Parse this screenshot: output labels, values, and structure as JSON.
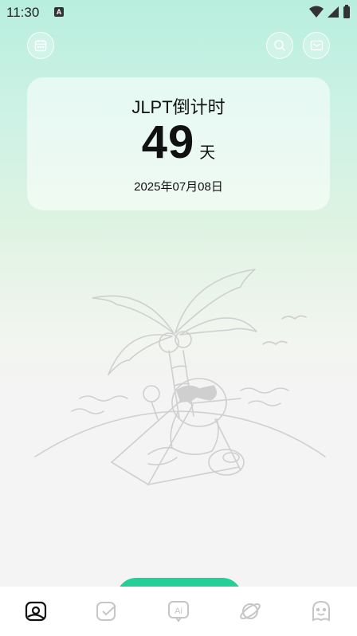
{
  "status_bar": {
    "time": "11:30",
    "notification_icon": "a-letter-icon",
    "indicators": [
      "wifi-icon",
      "signal-icon",
      "battery-icon"
    ]
  },
  "header": {
    "left_button_icon": "calendar-icon",
    "right_button_icons": [
      "search-icon",
      "mail-icon"
    ]
  },
  "countdown": {
    "title": "JLPT倒计时",
    "days": "49",
    "unit": "天",
    "date": "2025年07月08日"
  },
  "illustration": {
    "icon": "beach-palm-chair-illustration"
  },
  "tab_bar": {
    "tabs": [
      {
        "icon": "home-card-icon",
        "active": true
      },
      {
        "icon": "checklist-icon",
        "active": false
      },
      {
        "icon": "ai-icon",
        "label": "Ai",
        "active": false
      },
      {
        "icon": "planet-icon",
        "active": false
      },
      {
        "icon": "ghost-profile-icon",
        "active": false
      }
    ]
  },
  "colors": {
    "accent": "#24cf98",
    "text": "#111111"
  }
}
